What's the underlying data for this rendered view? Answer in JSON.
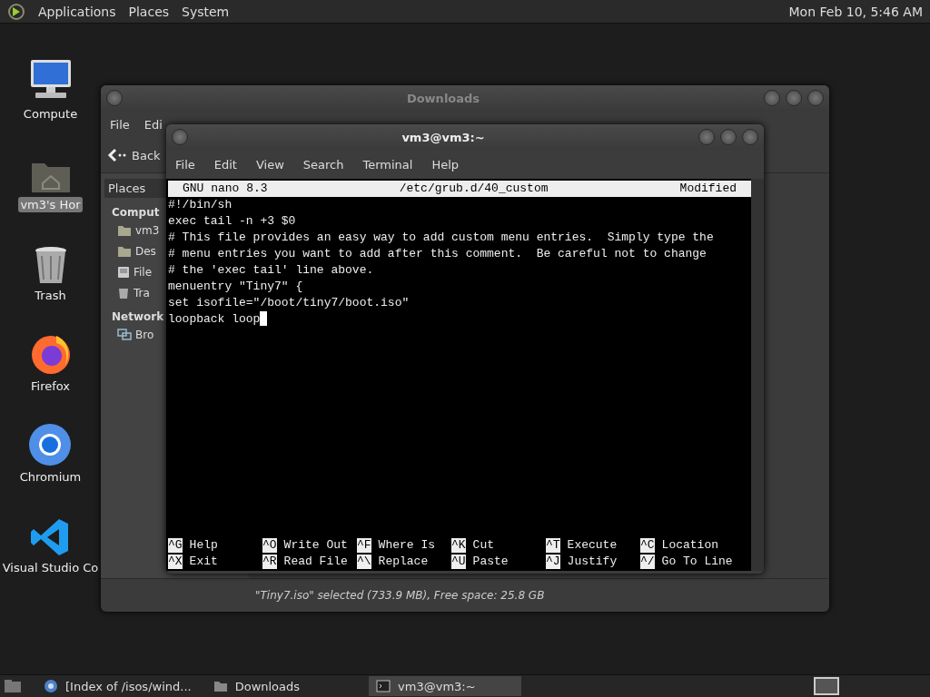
{
  "top_panel": {
    "menus": [
      "Applications",
      "Places",
      "System"
    ],
    "clock": "Mon Feb 10, 5:46 AM"
  },
  "desktop_icons": [
    {
      "label": "Compute",
      "kind": "computer",
      "selected": false
    },
    {
      "label": "vm3's Hor",
      "kind": "home",
      "selected": true
    },
    {
      "label": "Trash",
      "kind": "trash",
      "selected": false
    },
    {
      "label": "Firefox",
      "kind": "firefox",
      "selected": false
    },
    {
      "label": "Chromium",
      "kind": "chromium",
      "selected": false
    },
    {
      "label": "Visual Studio Co",
      "kind": "vscode",
      "selected": false
    }
  ],
  "file_manager": {
    "title": "Downloads",
    "menu": [
      "File",
      "Edi"
    ],
    "back": "Back",
    "sidebar_title": "Places",
    "sections": [
      {
        "heading": "Comput",
        "items": [
          {
            "label": "vm3",
            "kind": "home"
          },
          {
            "label": "Des",
            "kind": "desktop"
          },
          {
            "label": "File",
            "kind": "drive"
          },
          {
            "label": "Tra",
            "kind": "trash"
          }
        ]
      },
      {
        "heading": "Network",
        "items": [
          {
            "label": "Bro",
            "kind": "network"
          }
        ]
      }
    ],
    "status": "\"Tiny7.iso\" selected (733.9 MB), Free space: 25.8 GB"
  },
  "terminal": {
    "title": "vm3@vm3:~",
    "menu": [
      "File",
      "Edit",
      "View",
      "Search",
      "Terminal",
      "Help"
    ],
    "nano_header": {
      "version": "GNU nano 8.3",
      "file": "/etc/grub.d/40_custom",
      "state": "Modified"
    },
    "lines": [
      "#!/bin/sh",
      "exec tail -n +3 $0",
      "# This file provides an easy way to add custom menu entries.  Simply type the",
      "# menu entries you want to add after this comment.  Be careful not to change",
      "# the 'exec tail' line above.",
      "menuentry \"Tiny7\" {",
      "set isofile=\"/boot/tiny7/boot.iso\"",
      "loopback loop"
    ],
    "shortcuts": [
      {
        "key": "^G",
        "label": "Help"
      },
      {
        "key": "^O",
        "label": "Write Out"
      },
      {
        "key": "^F",
        "label": "Where Is"
      },
      {
        "key": "^K",
        "label": "Cut"
      },
      {
        "key": "^T",
        "label": "Execute"
      },
      {
        "key": "^C",
        "label": "Location"
      },
      {
        "key": "^X",
        "label": "Exit"
      },
      {
        "key": "^R",
        "label": "Read File"
      },
      {
        "key": "^\\",
        "label": "Replace"
      },
      {
        "key": "^U",
        "label": "Paste"
      },
      {
        "key": "^J",
        "label": "Justify"
      },
      {
        "key": "^/",
        "label": "Go To Line"
      }
    ]
  },
  "taskbar": {
    "items": [
      {
        "label": "[Index of /isos/wind...",
        "kind": "browser",
        "selected": false
      },
      {
        "label": "Downloads",
        "kind": "folder",
        "selected": false
      },
      {
        "label": "vm3@vm3:~",
        "kind": "terminal",
        "selected": true
      }
    ]
  }
}
